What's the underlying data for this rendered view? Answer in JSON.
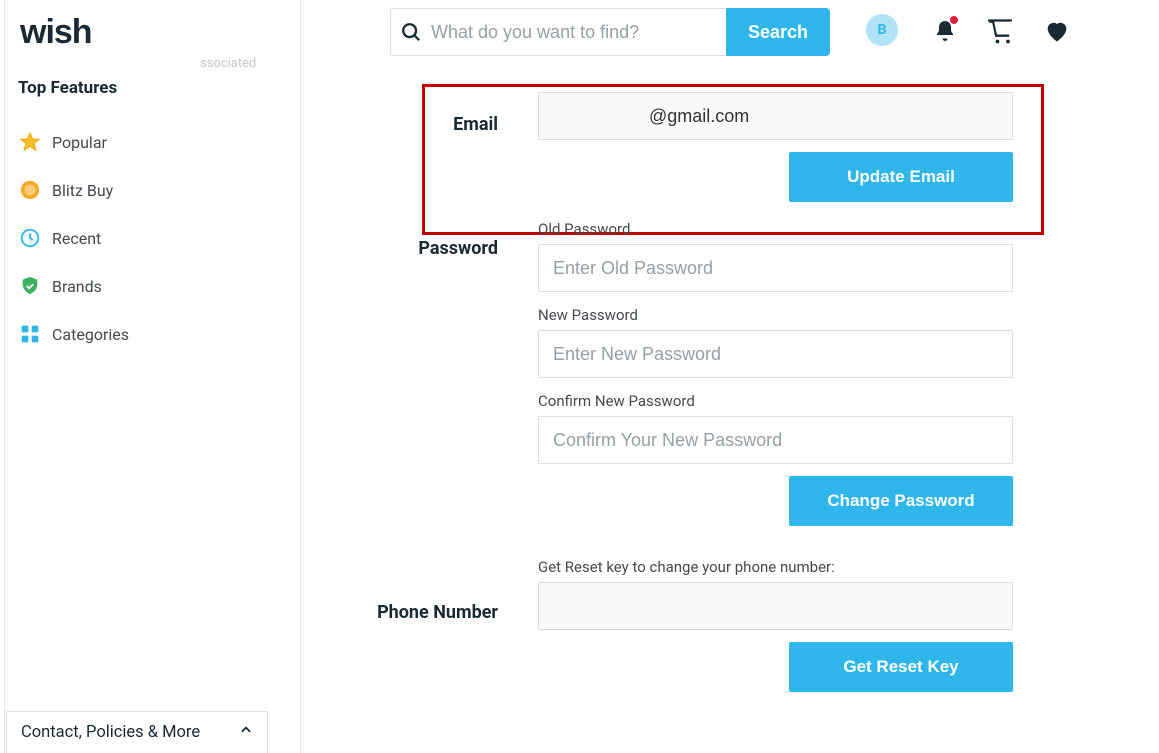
{
  "header": {
    "logo": "wish",
    "search_placeholder": "What do you want to find?",
    "search_button": "Search",
    "avatar_initial": "B"
  },
  "sidebar": {
    "title": "Top Features",
    "items": [
      {
        "label": "Popular"
      },
      {
        "label": "Blitz Buy"
      },
      {
        "label": "Recent"
      },
      {
        "label": "Brands"
      },
      {
        "label": "Categories"
      }
    ],
    "secondary_truncated": "ssociated"
  },
  "account": {
    "email": {
      "label": "Email",
      "value": "@gmail.com",
      "button": "Update Email"
    },
    "password": {
      "label": "Password",
      "old_label": "Old Password",
      "old_placeholder": "Enter Old Password",
      "new_label": "New Password",
      "new_placeholder": "Enter New Password",
      "confirm_label": "Confirm New Password",
      "confirm_placeholder": "Confirm Your New Password",
      "button": "Change Password"
    },
    "phone": {
      "label": "Phone Number",
      "sublabel": "Get Reset key to change your phone number:",
      "button": "Get Reset Key"
    }
  },
  "footer": {
    "label": "Contact, Policies & More"
  }
}
